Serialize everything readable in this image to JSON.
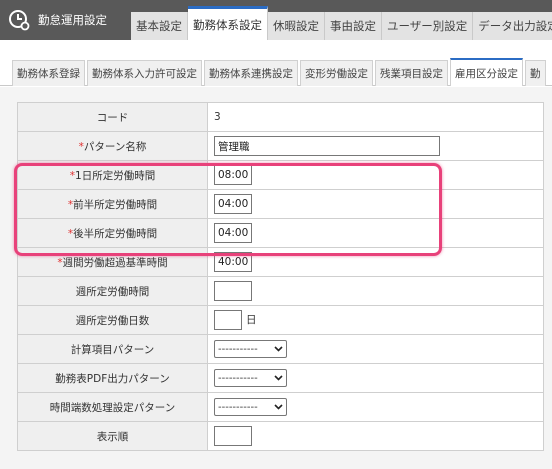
{
  "app": {
    "title": "勤怠運用設定",
    "icon": "clock-gear-icon"
  },
  "main_tabs": [
    {
      "label": "基本設定",
      "active": false
    },
    {
      "label": "勤務体系設定",
      "active": true
    },
    {
      "label": "休暇設定",
      "active": false
    },
    {
      "label": "事由設定",
      "active": false
    },
    {
      "label": "ユーザー別設定",
      "active": false
    },
    {
      "label": "データ出力設定",
      "active": false
    }
  ],
  "sub_tabs": [
    {
      "label": "勤務体系登録",
      "active": false
    },
    {
      "label": "勤務体系入力許可設定",
      "active": false
    },
    {
      "label": "勤務体系連携設定",
      "active": false
    },
    {
      "label": "変形労働設定",
      "active": false
    },
    {
      "label": "残業項目設定",
      "active": false
    },
    {
      "label": "雇用区分設定",
      "active": true
    },
    {
      "label": "勤",
      "active": false
    }
  ],
  "form": {
    "required_mark": "*",
    "rows": [
      {
        "label": "コード",
        "required": false,
        "value": "3"
      },
      {
        "label": "パターン名称",
        "required": true,
        "value": "管理職"
      },
      {
        "label": "1日所定労働時間",
        "required": true,
        "value": "08:00"
      },
      {
        "label": "前半所定労働時間",
        "required": true,
        "value": "04:00"
      },
      {
        "label": "後半所定労働時間",
        "required": true,
        "value": "04:00"
      },
      {
        "label": "週間労働超過基準時間",
        "required": true,
        "value": "40:00"
      },
      {
        "label": "週所定労働時間",
        "required": false,
        "value": ""
      },
      {
        "label": "週所定労働日数",
        "required": false,
        "value": "",
        "unit": "日"
      },
      {
        "label": "計算項目パターン",
        "required": false,
        "select": "-----------"
      },
      {
        "label": "勤務表PDF出力パターン",
        "required": false,
        "select": "-----------"
      },
      {
        "label": "時間端数処理設定パターン",
        "required": false,
        "select": "-----------"
      },
      {
        "label": "表示順",
        "required": false,
        "value": ""
      }
    ]
  },
  "colors": {
    "accent": "#2b6cc4",
    "highlight": "#e8417a",
    "required": "#e03030",
    "topbar": "#595959"
  }
}
